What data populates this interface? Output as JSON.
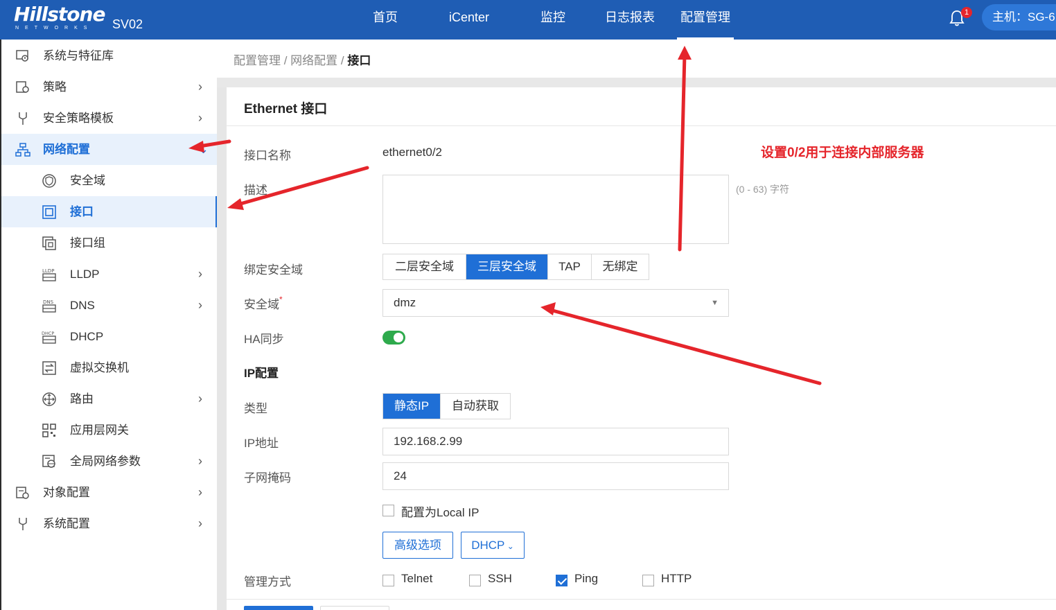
{
  "header": {
    "brand": "Hillstone",
    "brand_sub": "NETWORKS",
    "device": "SV02",
    "nav": [
      "首页",
      "iCenter",
      "监控",
      "日志报表",
      "配置管理"
    ],
    "active_nav": "配置管理",
    "notification_count": "1",
    "host": "主机：SG-6"
  },
  "sidebar": {
    "items": [
      {
        "label": "系统与特征库",
        "icon": "system-icon"
      },
      {
        "label": "策略",
        "icon": "policy-icon",
        "chevron": "›"
      },
      {
        "label": "安全策略模板",
        "icon": "template-icon",
        "chevron": "›"
      },
      {
        "label": "网络配置",
        "icon": "network-icon",
        "chevron": "⌄"
      },
      {
        "label": "安全域",
        "icon": "zone-icon"
      },
      {
        "label": "接口",
        "icon": "interface-icon"
      },
      {
        "label": "接口组",
        "icon": "interface-group-icon"
      },
      {
        "label": "LLDP",
        "icon": "lldp-icon",
        "chevron": "›"
      },
      {
        "label": "DNS",
        "icon": "dns-icon",
        "chevron": "›"
      },
      {
        "label": "DHCP",
        "icon": "dhcp-icon"
      },
      {
        "label": "虚拟交换机",
        "icon": "vswitch-icon"
      },
      {
        "label": "路由",
        "icon": "route-icon",
        "chevron": "›"
      },
      {
        "label": "应用层网关",
        "icon": "alg-icon"
      },
      {
        "label": "全局网络参数",
        "icon": "global-params-icon",
        "chevron": "›"
      },
      {
        "label": "对象配置",
        "icon": "object-icon",
        "chevron": "›"
      },
      {
        "label": "系统配置",
        "icon": "sysconfig-icon",
        "chevron": "›"
      }
    ]
  },
  "breadcrumb": {
    "part1": "配置管理",
    "sep": " / ",
    "part2": "网络配置",
    "current": "接口"
  },
  "form": {
    "title": "Ethernet 接口",
    "name_label": "接口名称",
    "name_value": "ethernet0/2",
    "desc_label": "描述",
    "desc_value": "",
    "desc_hint": "(0 - 63) 字符",
    "bind_label": "绑定安全域",
    "bind_options": [
      "二层安全域",
      "三层安全域",
      "TAP",
      "无绑定"
    ],
    "bind_selected": "三层安全域",
    "zone_label": "安全域",
    "zone_required": "*",
    "zone_value": "dmz",
    "ha_label": "HA同步",
    "ha_on": true,
    "ip_section": "IP配置",
    "type_label": "类型",
    "type_options": [
      "静态IP",
      "自动获取"
    ],
    "type_selected": "静态IP",
    "ip_label": "IP地址",
    "ip_value": "192.168.2.99",
    "mask_label": "子网掩码",
    "mask_value": "24",
    "local_ip_label": "配置为Local IP",
    "advanced_button": "高级选项",
    "dhcp_button": "DHCP",
    "mgmt_label": "管理方式",
    "mgmt": [
      {
        "label": "Telnet",
        "checked": false
      },
      {
        "label": "SSH",
        "checked": false
      },
      {
        "label": "Ping",
        "checked": true
      },
      {
        "label": "HTTP",
        "checked": false
      }
    ]
  },
  "annotation": {
    "text": "设置0/2用于连接内部服务器",
    "color": "#e5252b"
  },
  "colors": {
    "topbar": "#1f5db4",
    "accent": "#1f6fd6",
    "toggle_on": "#2eaa4c"
  }
}
